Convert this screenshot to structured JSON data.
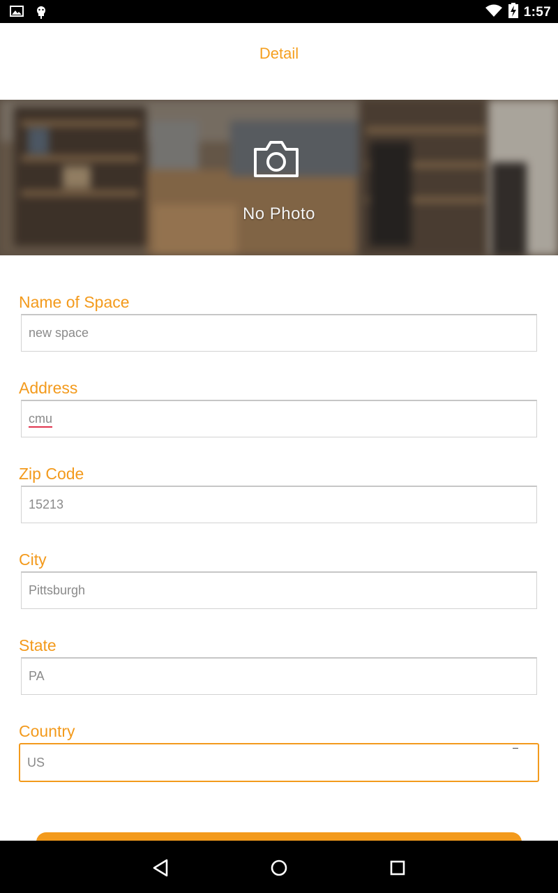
{
  "status_bar": {
    "time": "1:57",
    "icons": [
      "image-notification-icon",
      "android-debug-icon",
      "wifi-icon",
      "battery-charging-icon"
    ]
  },
  "header": {
    "title": "Detail"
  },
  "photo": {
    "label": "No Photo",
    "icon": "camera-icon"
  },
  "form": {
    "fields": [
      {
        "label": "Name of Space",
        "value": "new space"
      },
      {
        "label": "Address",
        "value": "cmu"
      },
      {
        "label": "Zip Code",
        "value": "15213"
      },
      {
        "label": "City",
        "value": "Pittsburgh"
      },
      {
        "label": "State",
        "value": "PA"
      },
      {
        "label": "Country",
        "value": "US"
      }
    ]
  },
  "nav_bar": {
    "icons": [
      "back-icon",
      "home-icon",
      "recents-icon"
    ]
  },
  "colors": {
    "accent": "#f39a1c",
    "status_bar": "#000000",
    "input_text": "#8a8a8a"
  }
}
